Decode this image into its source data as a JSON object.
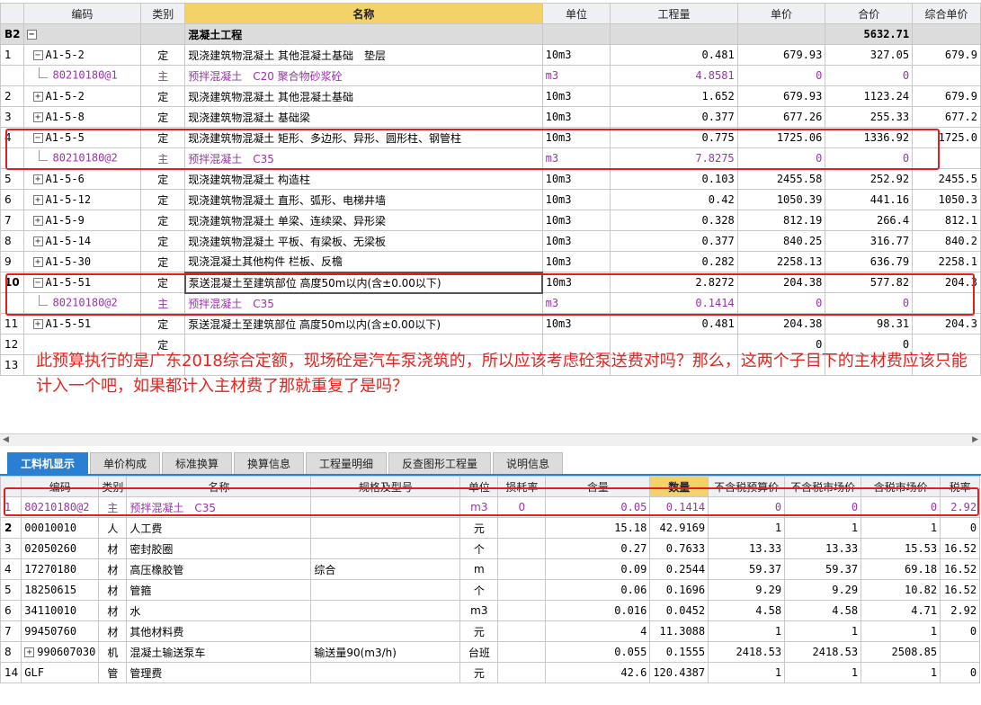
{
  "top_grid": {
    "headers": [
      "编码",
      "类别",
      "名称",
      "单位",
      "工程量",
      "单价",
      "合价",
      "综合单价"
    ],
    "section": {
      "rowno": "B2",
      "name": "混凝土工程",
      "total": "5632.71"
    },
    "rows": [
      {
        "rowno": "1",
        "expand": "−",
        "code": "A1-5-2",
        "type": "定",
        "name": "现浇建筑物混凝土 其他混凝土基础　垫层",
        "unit": "10m3",
        "qty": "0.481",
        "price": "679.93",
        "total": "327.05",
        "unitprice": "679.9",
        "child": false
      },
      {
        "rowno": "",
        "expand": "",
        "code": "80210180@1",
        "type": "主",
        "name": "预拌混凝土　C20 聚合物砂浆砼",
        "unit": "m3",
        "qty": "4.8581",
        "price": "0",
        "total": "0",
        "unitprice": "",
        "child": true
      },
      {
        "rowno": "2",
        "expand": "+",
        "code": "A1-5-2",
        "type": "定",
        "name": "现浇建筑物混凝土 其他混凝土基础",
        "unit": "10m3",
        "qty": "1.652",
        "price": "679.93",
        "total": "1123.24",
        "unitprice": "679.9",
        "child": false
      },
      {
        "rowno": "3",
        "expand": "+",
        "code": "A1-5-8",
        "type": "定",
        "name": "现浇建筑物混凝土 基础梁",
        "unit": "10m3",
        "qty": "0.377",
        "price": "677.26",
        "total": "255.33",
        "unitprice": "677.2",
        "child": false
      },
      {
        "rowno": "4",
        "expand": "−",
        "code": "A1-5-5",
        "type": "定",
        "name": "现浇建筑物混凝土 矩形、多边形、异形、圆形柱、钢管柱",
        "unit": "10m3",
        "qty": "0.775",
        "price": "1725.06",
        "total": "1336.92",
        "unitprice": "1725.0",
        "child": false
      },
      {
        "rowno": "",
        "expand": "",
        "code": "80210180@2",
        "type": "主",
        "name": "预拌混凝土　C35",
        "unit": "m3",
        "qty": "7.8275",
        "price": "0",
        "total": "0",
        "unitprice": "",
        "child": true
      },
      {
        "rowno": "5",
        "expand": "+",
        "code": "A1-5-6",
        "type": "定",
        "name": "现浇建筑物混凝土 构造柱",
        "unit": "10m3",
        "qty": "0.103",
        "price": "2455.58",
        "total": "252.92",
        "unitprice": "2455.5",
        "child": false
      },
      {
        "rowno": "6",
        "expand": "+",
        "code": "A1-5-12",
        "type": "定",
        "name": "现浇建筑物混凝土 直形、弧形、电梯井墙",
        "unit": "10m3",
        "qty": "0.42",
        "price": "1050.39",
        "total": "441.16",
        "unitprice": "1050.3",
        "child": false
      },
      {
        "rowno": "7",
        "expand": "+",
        "code": "A1-5-9",
        "type": "定",
        "name": "现浇建筑物混凝土 单梁、连续梁、异形梁",
        "unit": "10m3",
        "qty": "0.328",
        "price": "812.19",
        "total": "266.4",
        "unitprice": "812.1",
        "child": false
      },
      {
        "rowno": "8",
        "expand": "+",
        "code": "A1-5-14",
        "type": "定",
        "name": "现浇建筑物混凝土 平板、有梁板、无梁板",
        "unit": "10m3",
        "qty": "0.377",
        "price": "840.25",
        "total": "316.77",
        "unitprice": "840.2",
        "child": false
      },
      {
        "rowno": "9",
        "expand": "+",
        "code": "A1-5-30",
        "type": "定",
        "name": "现浇混凝土其他构件 栏板、反檐",
        "unit": "10m3",
        "qty": "0.282",
        "price": "2258.13",
        "total": "636.79",
        "unitprice": "2258.1",
        "child": false
      },
      {
        "rowno": "10",
        "expand": "−",
        "code": "A1-5-51",
        "type": "定",
        "name": "泵送混凝土至建筑部位 高度50m以内(含±0.00以下)",
        "unit": "10m3",
        "qty": "2.8272",
        "price": "204.38",
        "total": "577.82",
        "unitprice": "204.3",
        "child": false
      },
      {
        "rowno": "",
        "expand": "",
        "code": "80210180@2",
        "type": "主",
        "name": "预拌混凝土　C35",
        "unit": "m3",
        "qty": "0.1414",
        "price": "0",
        "total": "0",
        "unitprice": "",
        "child": true
      },
      {
        "rowno": "11",
        "expand": "+",
        "code": "A1-5-51",
        "type": "定",
        "name": "泵送混凝土至建筑部位 高度50m以内(含±0.00以下)",
        "unit": "10m3",
        "qty": "0.481",
        "price": "204.38",
        "total": "98.31",
        "unitprice": "204.3",
        "child": false
      },
      {
        "rowno": "12",
        "expand": "",
        "code": "",
        "type": "定",
        "name": "",
        "unit": "",
        "qty": "",
        "price": "0",
        "total": "0",
        "unitprice": "",
        "child": false
      },
      {
        "rowno": "13",
        "expand": "",
        "code": "",
        "type": "",
        "name": "",
        "unit": "",
        "qty": "",
        "price": "",
        "total": "",
        "unitprice": "",
        "child": false
      }
    ]
  },
  "note": "此预算执行的是广东2018综合定额，现场砼是汽车泵浇筑的，所以应该考虑砼泵送费对吗？那么，这两个子目下的主材费应该只能计入一个吧，如果都计入主材费了那就重复了是吗？",
  "tabs": [
    "工料机显示",
    "单价构成",
    "标准换算",
    "换算信息",
    "工程量明细",
    "反查图形工程量",
    "说明信息"
  ],
  "bottom_grid": {
    "headers": [
      "",
      "编码",
      "类别",
      "名称",
      "规格及型号",
      "单位",
      "损耗率",
      "含量",
      "数量",
      "不含税预算价",
      "不含税市场价",
      "含税市场价",
      "税率"
    ],
    "rows": [
      {
        "rowno": "1",
        "code": "80210180@2",
        "type": "主",
        "name": "预拌混凝土　C35",
        "spec": "",
        "unit": "m3",
        "loss": "0",
        "content": "0.05",
        "qty": "0.1414",
        "budget": "0",
        "market": "0",
        "market_tax": "0",
        "tax": "2.92",
        "purple": true
      },
      {
        "rowno": "2",
        "code": "00010010",
        "type": "人",
        "name": "人工费",
        "spec": "",
        "unit": "元",
        "loss": "",
        "content": "15.18",
        "qty": "42.9169",
        "budget": "1",
        "market": "1",
        "market_tax": "1",
        "tax": "0",
        "purple": false
      },
      {
        "rowno": "3",
        "code": "02050260",
        "type": "材",
        "name": "密封胶圈",
        "spec": "",
        "unit": "个",
        "loss": "",
        "content": "0.27",
        "qty": "0.7633",
        "budget": "13.33",
        "market": "13.33",
        "market_tax": "15.53",
        "tax": "16.52",
        "purple": false
      },
      {
        "rowno": "4",
        "code": "17270180",
        "type": "材",
        "name": "高压橡胶管",
        "spec": "综合",
        "unit": "m",
        "loss": "",
        "content": "0.09",
        "qty": "0.2544",
        "budget": "59.37",
        "market": "59.37",
        "market_tax": "69.18",
        "tax": "16.52",
        "purple": false
      },
      {
        "rowno": "5",
        "code": "18250615",
        "type": "材",
        "name": "管箍",
        "spec": "",
        "unit": "个",
        "loss": "",
        "content": "0.06",
        "qty": "0.1696",
        "budget": "9.29",
        "market": "9.29",
        "market_tax": "10.82",
        "tax": "16.52",
        "purple": false
      },
      {
        "rowno": "6",
        "code": "34110010",
        "type": "材",
        "name": "水",
        "spec": "",
        "unit": "m3",
        "loss": "",
        "content": "0.016",
        "qty": "0.0452",
        "budget": "4.58",
        "market": "4.58",
        "market_tax": "4.71",
        "tax": "2.92",
        "purple": false
      },
      {
        "rowno": "7",
        "code": "99450760",
        "type": "材",
        "name": "其他材料费",
        "spec": "",
        "unit": "元",
        "loss": "",
        "content": "4",
        "qty": "11.3088",
        "budget": "1",
        "market": "1",
        "market_tax": "1",
        "tax": "0",
        "purple": false
      },
      {
        "rowno": "8",
        "code": "990607030",
        "type": "机",
        "name": "混凝土输送泵车",
        "spec": "输送量90(m3/h)",
        "unit": "台班",
        "loss": "",
        "content": "0.055",
        "qty": "0.1555",
        "budget": "2418.53",
        "market": "2418.53",
        "market_tax": "2508.85",
        "tax": "",
        "purple": false,
        "expand": "+"
      },
      {
        "rowno": "14",
        "code": "GLF",
        "type": "管",
        "name": "管理费",
        "spec": "",
        "unit": "元",
        "loss": "",
        "content": "42.6",
        "qty": "120.4387",
        "budget": "1",
        "market": "1",
        "market_tax": "1",
        "tax": "0",
        "purple": false
      }
    ]
  }
}
